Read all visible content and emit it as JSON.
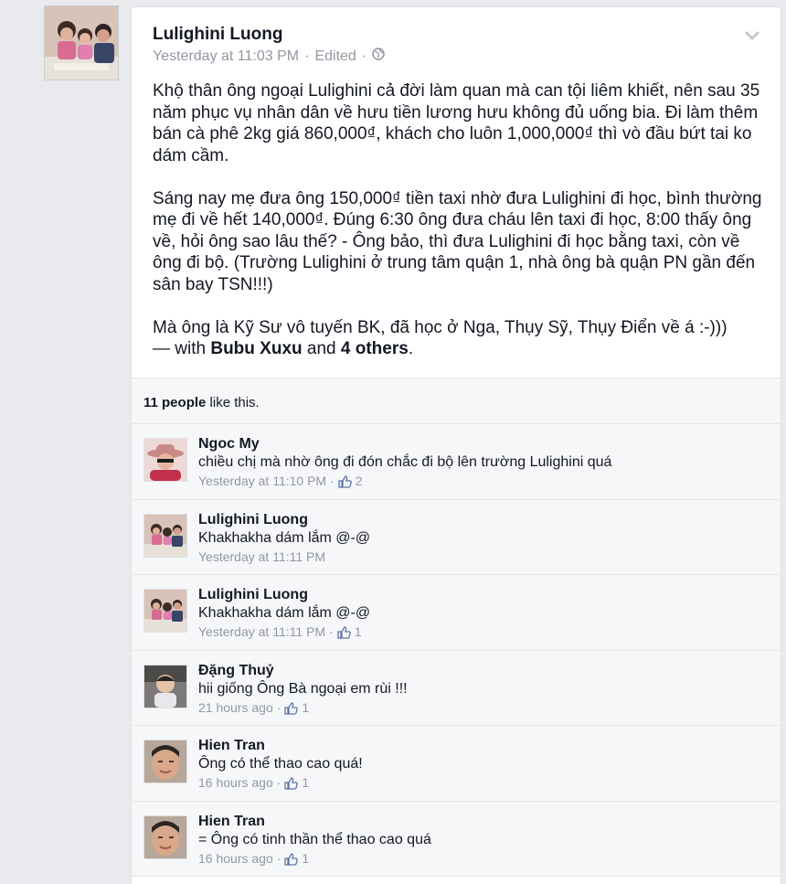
{
  "post": {
    "author": "Lulighini Luong",
    "timestamp": "Yesterday at 11:03 PM",
    "edited": "Edited",
    "separator": "·",
    "paragraph1": "Khộ thân ông ngoại Lulighini cả đời làm quan mà can tội liêm khiết, nên sau 35 năm phục vụ nhân dân về hưu tiền lương hưu không đủ uống bia. Đi làm thêm bán cà phê 2kg giá 860,000₫, khách cho luôn 1,000,000₫ thì vò đầu bứt tai ko dám cầm.",
    "paragraph2": "Sáng nay mẹ đưa ông 150,000₫ tiền taxi nhờ đưa Lulighini đi học, bình thường mẹ đi về hết 140,000₫. Đúng 6:30 ông đưa cháu lên taxi đi học, 8:00 thấy ông về, hỏi ông sao lâu thế? - Ông bảo, thì đưa Lulighini đi học bằng taxi, còn về ông đi bộ. (Trường Lulighini ở trung tâm quận 1, nhà ông bà quận PN gần đến sân bay TSN!!!)",
    "paragraph3": "Mà ông là Kỹ Sư vô tuyến BK, đã học ở Nga, Thụy Sỹ, Thụy Điển về á :-)))",
    "with_prefix": "— with ",
    "tag1": "Bubu Xuxu",
    "and_text": " and ",
    "tag2": "4 others",
    "period": "."
  },
  "likes": {
    "count_text": "11 people",
    "suffix": " like this."
  },
  "comments": [
    {
      "name": "Ngoc My",
      "text": "chiều chị mà nhờ ông đi đón chắc đi bộ lên trường Lulighini quá",
      "time": "Yesterday at 11:10 PM",
      "likes": "2",
      "avatar": "hat-woman"
    },
    {
      "name": "Lulighini Luong",
      "text": "Khakhakha dám lắm @-@",
      "time": "Yesterday at 11:11 PM",
      "likes": "",
      "avatar": "family"
    },
    {
      "name": "Lulighini Luong",
      "text": "Khakhakha dám lắm @-@",
      "time": "Yesterday at 11:11 PM",
      "likes": "1",
      "avatar": "family"
    },
    {
      "name": "Đặng Thuỷ",
      "text": "hii giống Ông Bà ngoại em rùi !!!",
      "time": "21 hours ago",
      "likes": "1",
      "avatar": "child"
    },
    {
      "name": "Hien Tran",
      "text": "Ông có thể thao cao quá!",
      "time": "16 hours ago",
      "likes": "1",
      "avatar": "face"
    },
    {
      "name": "Hien Tran",
      "text": "= Ông có tinh thần thể thao cao quá",
      "time": "16 hours ago",
      "likes": "1",
      "avatar": "face"
    }
  ],
  "colors": {
    "meta_gray": "#9197a3",
    "text": "#141823",
    "background": "#e9eaed"
  }
}
